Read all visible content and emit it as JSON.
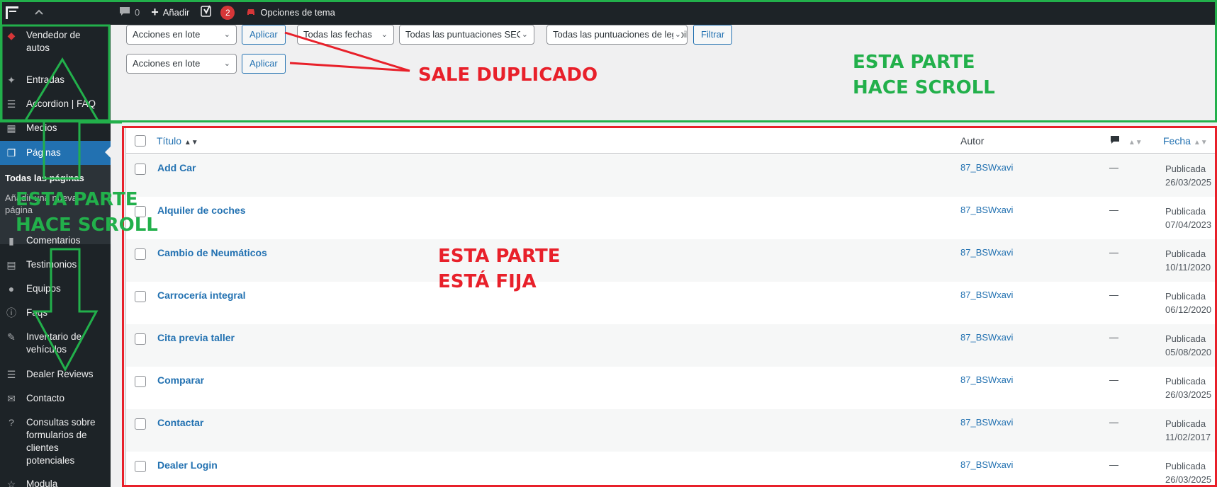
{
  "adminbar": {
    "comments_count": "0",
    "add_label": "Añadir",
    "yoast_count": "2",
    "theme_options_label": "Opciones de tema"
  },
  "sidebar": {
    "items": [
      {
        "label": "Vendedor de autos",
        "icon": "car-icon"
      },
      {
        "label": "Entradas",
        "icon": "pin-icon"
      },
      {
        "label": "Accordion | FAQ",
        "icon": "accordion-icon"
      },
      {
        "label": "Medios",
        "icon": "media-icon"
      },
      {
        "label": "Páginas",
        "icon": "pages-icon"
      },
      {
        "label": "Comentarios",
        "icon": "comments-icon"
      },
      {
        "label": "Testimonios",
        "icon": "testimonial-icon"
      },
      {
        "label": "Equipos",
        "icon": "team-icon"
      },
      {
        "label": "Faqs",
        "icon": "info-icon"
      },
      {
        "label": "Inventario de vehículos",
        "icon": "inventory-icon"
      },
      {
        "label": "Dealer Reviews",
        "icon": "reviews-icon"
      },
      {
        "label": "Contacto",
        "icon": "mail-icon"
      },
      {
        "label": "Consultas sobre formularios de clientes potenciales",
        "icon": "help-icon"
      },
      {
        "label": "Modula",
        "icon": "star-icon"
      }
    ],
    "submenu": {
      "all_pages": "Todas las páginas",
      "add_new": "Añadir una nueva página"
    }
  },
  "tablenav": {
    "bulk_actions": "Acciones en lote",
    "apply": "Aplicar",
    "all_dates": "Todas las fechas",
    "seo_scores": "Todas las puntuaciones SEO",
    "readability_scores": "Todas las puntuaciones de legibilidad",
    "filter": "Filtrar"
  },
  "table": {
    "headers": {
      "title": "Título",
      "author": "Autor",
      "date": "Fecha"
    },
    "rows": [
      {
        "title": "Add Car",
        "author": "87_BSWxavi",
        "comments": "—",
        "status": "Publicada",
        "date": "26/03/2025"
      },
      {
        "title": "Alquiler de coches",
        "author": "87_BSWxavi",
        "comments": "—",
        "status": "Publicada",
        "date": "07/04/2023"
      },
      {
        "title": "Cambio de Neumáticos",
        "author": "87_BSWxavi",
        "comments": "—",
        "status": "Publicada",
        "date": "10/11/2020"
      },
      {
        "title": "Carrocería integral",
        "author": "87_BSWxavi",
        "comments": "—",
        "status": "Publicada",
        "date": "06/12/2020"
      },
      {
        "title": "Cita previa taller",
        "author": "87_BSWxavi",
        "comments": "—",
        "status": "Publicada",
        "date": "05/08/2020"
      },
      {
        "title": "Comparar",
        "author": "87_BSWxavi",
        "comments": "—",
        "status": "Publicada",
        "date": "26/03/2025"
      },
      {
        "title": "Contactar",
        "author": "87_BSWxavi",
        "comments": "—",
        "status": "Publicada",
        "date": "11/02/2017"
      },
      {
        "title": "Dealer Login",
        "author": "87_BSWxavi",
        "comments": "—",
        "status": "Publicada",
        "date": "26/03/2025"
      }
    ]
  },
  "annotations": {
    "duplicated": "SALE DUPLICADO",
    "scroll_top_l1": "ESTA PARTE",
    "scroll_top_l2": "HACE SCROLL",
    "scroll_side_l1": "ESTA PARTE",
    "scroll_side_l2": "HACE SCROLL",
    "fixed_l1": "ESTA PARTE",
    "fixed_l2": "ESTÁ FIJA"
  },
  "colors": {
    "annotation_green": "#22b04b",
    "annotation_red": "#e8202a",
    "wp_blue": "#2271b1",
    "admin_dark": "#1d2327"
  }
}
